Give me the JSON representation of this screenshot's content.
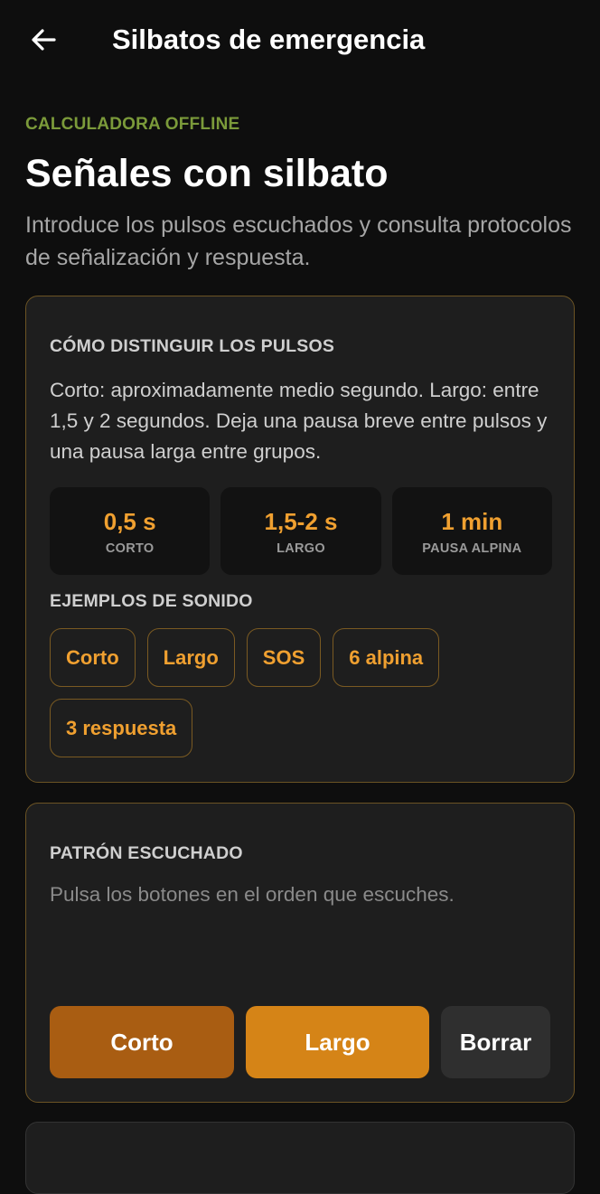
{
  "appbar": {
    "title": "Silbatos de emergencia",
    "back_icon": "arrow-left-icon"
  },
  "header": {
    "eyebrow": "CALCULADORA OFFLINE",
    "title": "Señales con silbato",
    "subtitle": "Introduce los pulsos escuchados y consulta protocolos de señalización y respuesta."
  },
  "guide": {
    "heading": "CÓMO DISTINGUIR LOS PULSOS",
    "text": "Corto: aproximadamente medio segundo. Largo: entre 1,5 y 2 segundos. Deja una pausa breve entre pulsos y una pausa larga entre grupos.",
    "stats": [
      {
        "value": "0,5 s",
        "label": "CORTO"
      },
      {
        "value": "1,5-2 s",
        "label": "LARGO"
      },
      {
        "value": "1 min",
        "label": "PAUSA ALPINA"
      }
    ],
    "examples_heading": "EJEMPLOS DE SONIDO",
    "examples": [
      "Corto",
      "Largo",
      "SOS",
      "6 alpina",
      "3 respuesta"
    ]
  },
  "pattern": {
    "heading": "PATRÓN ESCUCHADO",
    "hint": "Pulsa los botones en el orden que escuches.",
    "buttons": {
      "short": "Corto",
      "long": "Largo",
      "clear": "Borrar"
    }
  },
  "colors": {
    "background": "#0e0e0e",
    "card": "#1e1e1e",
    "card_border": "#6b5324",
    "accent": "#f0a030",
    "eyebrow": "#7b9a3a",
    "short_button": "#a95d12",
    "long_button": "#d58417",
    "clear_button": "#2f2f2f"
  }
}
